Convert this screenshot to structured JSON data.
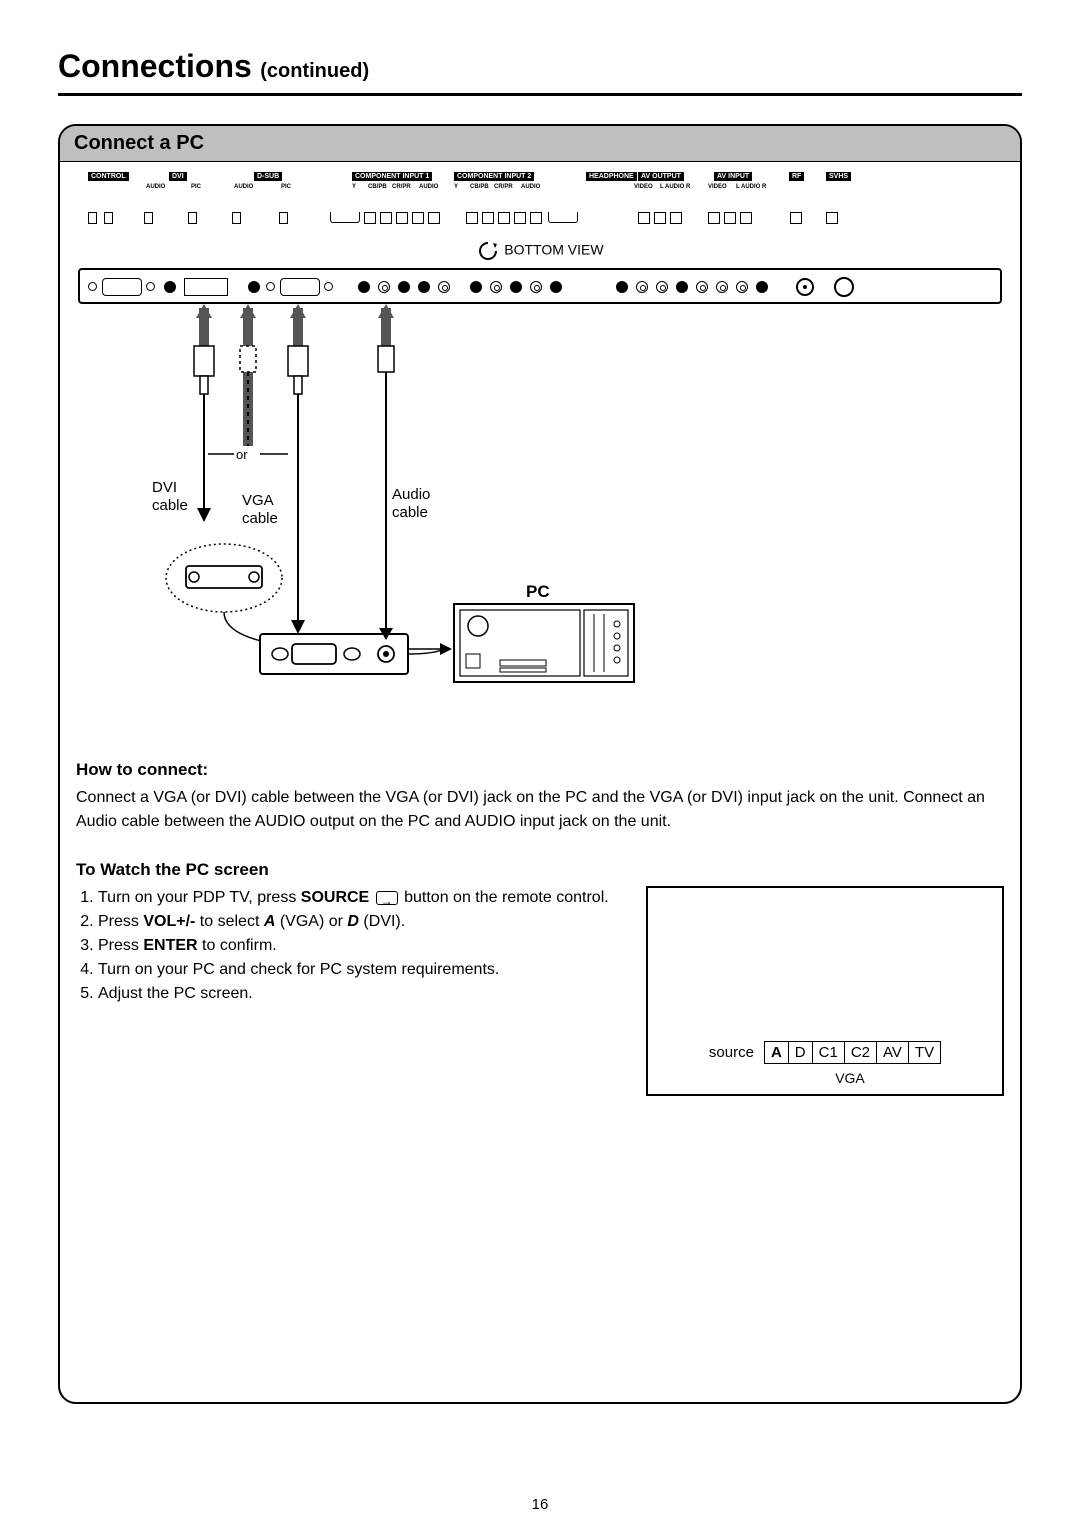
{
  "title": {
    "main": "Connections",
    "sub": "(continued)"
  },
  "section_header": "Connect a PC",
  "port_labels": {
    "control": "CONTROL",
    "dvi": "DVI",
    "dsub": "D-SUB",
    "audio": "AUDIO",
    "pic": "PIC",
    "comp1": "COMPONENT INPUT 1",
    "comp2": "COMPONENT INPUT 2",
    "y": "Y",
    "cbpb": "CB/PB",
    "crpr": "CR/PR",
    "audio2": "AUDIO",
    "headphone": "HEADPHONE",
    "avout": "AV OUTPUT",
    "avin": "AV INPUT",
    "video": "VIDEO",
    "laudio": "L AUDIO R",
    "rf": "RF",
    "svhs": "SVHS"
  },
  "bottom_view": "BOTTOM VIEW",
  "cable_labels": {
    "or": "or",
    "dvi": "DVI\ncable",
    "vga": "VGA\ncable",
    "audio": "Audio\ncable",
    "pc": "PC"
  },
  "how_to_connect": {
    "heading": "How to connect:",
    "body": "Connect a VGA (or DVI) cable between the VGA (or DVI) jack on the PC and the VGA (or DVI) input jack on the unit. Connect an Audio cable between the AUDIO output on the PC and AUDIO input jack on the unit."
  },
  "watch_pc": {
    "heading": "To Watch the PC screen",
    "step1a": "Turn on your PDP TV, press ",
    "step1_source": "SOURCE",
    "step1b": " button on the remote control.",
    "step2a": "Press ",
    "step2_vol": "VOL+/-",
    "step2b": " to select ",
    "step2_a": "A",
    "step2c": " (VGA) or ",
    "step2_d": "D",
    "step2d": " (DVI).",
    "step3a": "Press ",
    "step3_enter": "ENTER",
    "step3b": " to confirm.",
    "step4": "Turn on your PC and check for PC system requirements.",
    "step5": "Adjust the PC screen."
  },
  "osd": {
    "source": "source",
    "cells": [
      "A",
      "D",
      "C1",
      "C2",
      "AV",
      "TV"
    ],
    "selected_index": 0,
    "sub": "VGA"
  },
  "page_number": "16"
}
